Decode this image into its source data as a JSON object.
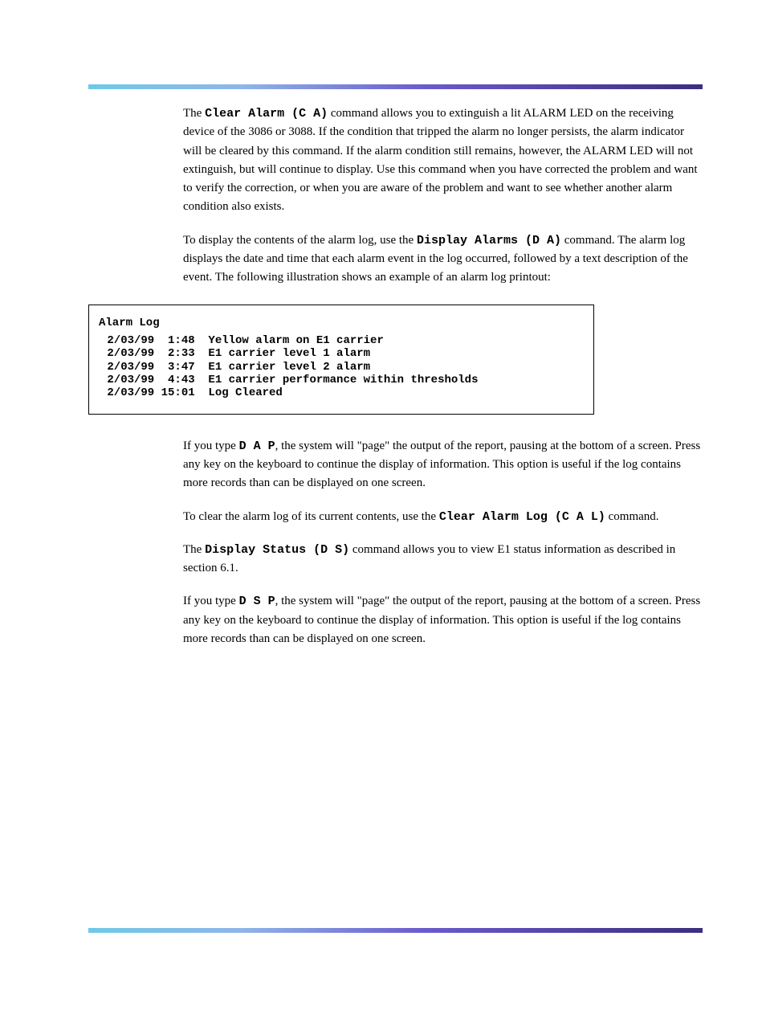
{
  "section1": {
    "lead_in": "The ",
    "cmd": "Clear Alarm (C A)",
    "rest": " command allows you to extinguish a lit ALARM LED on the receiving device of the 3086 or 3088. If the condition that tripped the alarm no longer persists, the alarm indicator will be cleared by this command. If the alarm condition still remains, however, the ALARM LED will not extinguish, but will continue to display. Use this command when you have corrected the problem and want to verify the correction, or when you are aware of the problem and want to see whether another alarm condition also exists."
  },
  "section2": {
    "lead_in": "To display the contents of the alarm log, use the ",
    "cmd": "Display Alarms (D A)",
    "rest": " command. The alarm log displays the date and time that each alarm event in the log occurred, followed by a text description of the event. The following illustration shows an example of an alarm log printout:"
  },
  "alarm_log": {
    "title": "Alarm Log",
    "entries": [
      {
        "date": "2/03/99",
        "time": " 1:48",
        "msg": "Yellow alarm on E1 carrier"
      },
      {
        "date": "2/03/99",
        "time": " 2:33",
        "msg": "E1 carrier level 1 alarm"
      },
      {
        "date": "2/03/99",
        "time": " 3:47",
        "msg": "E1 carrier level 2 alarm"
      },
      {
        "date": "2/03/99",
        "time": " 4:43",
        "msg": "E1 carrier performance within thresholds"
      },
      {
        "date": "2/03/99",
        "time": "15:01",
        "msg": "Log Cleared"
      }
    ]
  },
  "section3": {
    "lead_in": "If you type ",
    "cmd": "D A P",
    "rest": ", the system will \"page\" the output of the report, pausing at the bottom of a screen. Press any key on the keyboard to continue the display of information. This option is useful if the log contains more records than can be displayed on one screen."
  },
  "section4": {
    "lead_in": "To clear the alarm log of its current contents, use the ",
    "cmd1": "Clear Alarm Log (C A L)",
    "rest": " command."
  },
  "section5": {
    "lead_in": "The ",
    "cmd": "Display Status (D S)",
    "rest": " command allows you to view E1 status information as described in section 6.1."
  },
  "section6": {
    "lead_in": "If you type ",
    "cmd": "D S P",
    "rest": ", the system will \"page\" the output of the report, pausing at the bottom of a screen. Press any key on the keyboard to continue the display of information. This option is useful if the log contains more records than can be displayed on one screen."
  }
}
